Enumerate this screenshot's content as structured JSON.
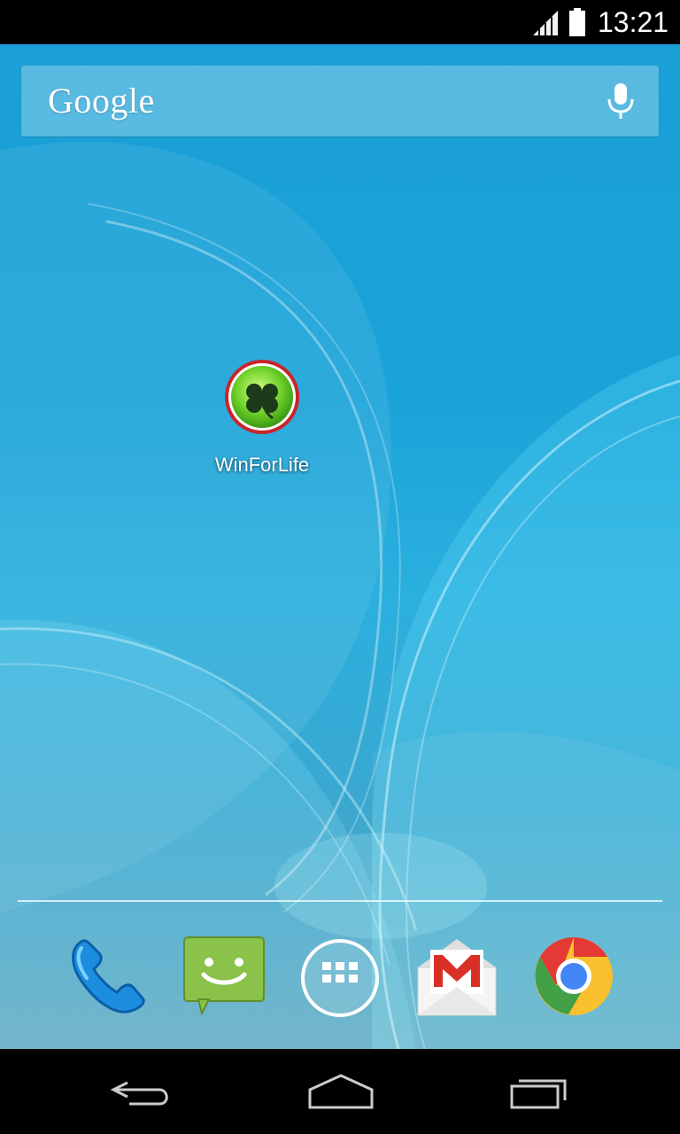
{
  "status_bar": {
    "time": "13:21",
    "icons": [
      "signal-icon",
      "battery-icon"
    ]
  },
  "search": {
    "logo_text": "Google",
    "icon": "mic-icon"
  },
  "home": {
    "apps": [
      {
        "label": "WinForLife",
        "icon": "clover-icon",
        "accent": "#6fd12a"
      }
    ]
  },
  "dock": {
    "items": [
      {
        "name": "phone",
        "icon": "phone-icon",
        "color": "#1d8de0"
      },
      {
        "name": "messaging",
        "icon": "messaging-icon",
        "color": "#8bc34a"
      },
      {
        "name": "app-drawer",
        "icon": "app-drawer-icon",
        "color": "#ffffff"
      },
      {
        "name": "gmail",
        "icon": "gmail-icon",
        "color": "#d93025"
      },
      {
        "name": "chrome",
        "icon": "chrome-icon",
        "color": "#4285f4"
      }
    ]
  },
  "nav_bar": {
    "buttons": [
      "back-icon",
      "home-icon",
      "recents-icon"
    ]
  }
}
